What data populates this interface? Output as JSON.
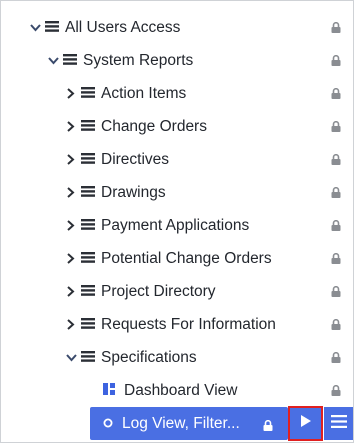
{
  "tree": {
    "items": [
      {
        "label": "All Users Access",
        "expanded": true,
        "icon": "folder-icon"
      },
      {
        "label": "System Reports",
        "expanded": true,
        "icon": "folder-icon"
      },
      {
        "label": "Action Items",
        "expanded": false,
        "icon": "folder-icon"
      },
      {
        "label": "Change Orders",
        "expanded": false,
        "icon": "folder-icon"
      },
      {
        "label": "Directives",
        "expanded": false,
        "icon": "folder-icon"
      },
      {
        "label": "Drawings",
        "expanded": false,
        "icon": "folder-icon"
      },
      {
        "label": "Payment Applications",
        "expanded": false,
        "icon": "folder-icon"
      },
      {
        "label": "Potential Change Orders",
        "expanded": false,
        "icon": "folder-icon"
      },
      {
        "label": "Project Directory",
        "expanded": false,
        "icon": "folder-icon"
      },
      {
        "label": "Requests For Information",
        "expanded": false,
        "icon": "folder-icon"
      },
      {
        "label": "Specifications",
        "expanded": true,
        "icon": "folder-icon"
      },
      {
        "label": "Dashboard View",
        "icon": "dashboard-icon"
      },
      {
        "label": "Log View, Filter...",
        "icon": "circle-icon",
        "selected": true
      }
    ]
  },
  "colors": {
    "accent": "#4a6fe3",
    "highlight_border": "#e02020",
    "text": "#23272e",
    "lock": "#8a8d92"
  },
  "icons": {
    "lock": "lock-icon",
    "play": "play-icon",
    "menu": "hamburger-menu-icon"
  }
}
